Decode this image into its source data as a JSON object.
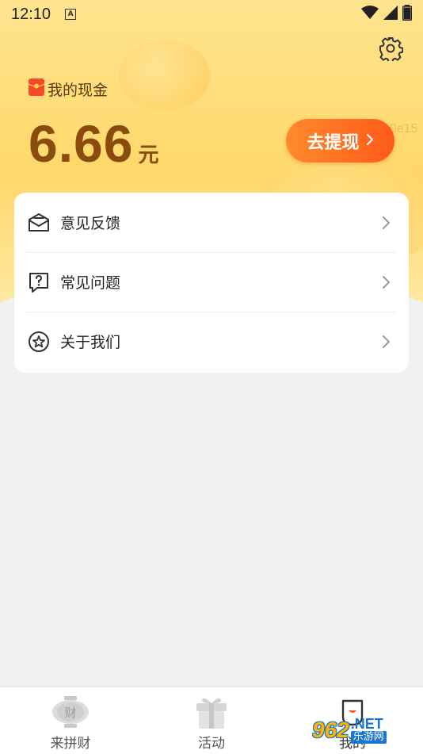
{
  "status_bar": {
    "time": "12:10",
    "notification_badge": "A"
  },
  "wallet": {
    "label": "我的现金",
    "amount": "6.66",
    "unit": "元",
    "withdraw_label": "去提现",
    "faint_id": "1a0e15"
  },
  "menu": {
    "items": [
      {
        "label": "意见反馈",
        "icon": "feedback-envelope-icon"
      },
      {
        "label": "常见问题",
        "icon": "question-bubble-icon"
      },
      {
        "label": "关于我们",
        "icon": "star-circle-icon"
      }
    ]
  },
  "tabbar": {
    "tabs": [
      {
        "label": "来拼财",
        "icon": "coin-lantern-icon"
      },
      {
        "label": "活动",
        "icon": "gift-box-icon"
      },
      {
        "label": "我的",
        "icon": "profile-icon"
      }
    ],
    "active_index": 2
  },
  "watermark": {
    "logo": "962",
    "domain": ".NET",
    "site_name": "乐游网"
  },
  "colors": {
    "hero_yellow": "#ffd86a",
    "amount_brown": "#8a4b0c",
    "withdraw_orange": "#ff6a1f",
    "page_bg": "#f1f1f1"
  }
}
